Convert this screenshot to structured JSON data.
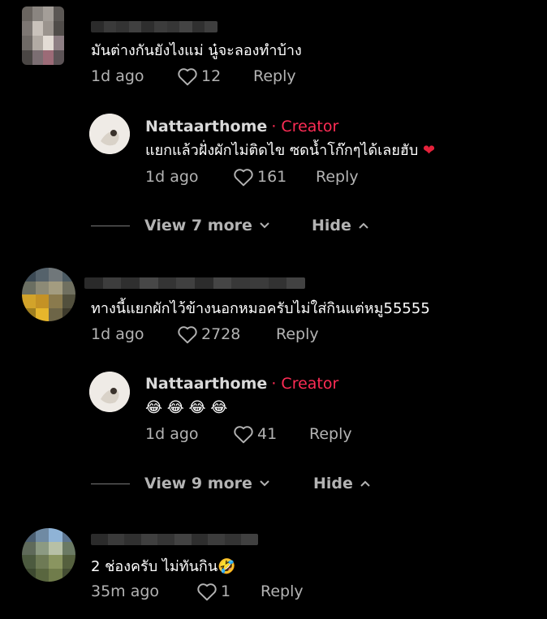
{
  "comments": [
    {
      "text": "มันต่างกันยังไงแม่ นู๋จะลองทำบ้าง",
      "time": "1d ago",
      "likes": "12",
      "reply_label": "Reply",
      "avatar_colors": [
        "#6a6560",
        "#8a8580",
        "#a49e98",
        "#5b5754",
        "#7d7773",
        "#c9c2bb",
        "#9b948e",
        "#504c49",
        "#6f6a66",
        "#b2aba4",
        "#e3dcd5",
        "#8e7f84",
        "#4a4644",
        "#7b6e72",
        "#9c6b77",
        "#5c5356"
      ],
      "name_colors": [
        "#2b2b2b",
        "#3a3a3a",
        "#333",
        "#404040",
        "#2e2e2e",
        "#3c3c3c",
        "#363636",
        "#444",
        "#303030",
        "#3e3e3e"
      ],
      "reply": {
        "author": "Nattaarthome",
        "tag": "· Creator",
        "text": "แยกแล้วฝั่งผักไม่ติดไข ซดน้ำโก๊กๆได้เลยฮับ",
        "emoji": "❤",
        "time": "1d ago",
        "likes": "161",
        "reply_label": "Reply"
      },
      "view_more": "View 7 more",
      "hide": "Hide"
    },
    {
      "text": "ทางนี้แยกผักไว้ข้างนอกหมอครับไม่ใส่กินแต่หมู55555",
      "time": "1d ago",
      "likes": "2728",
      "reply_label": "Reply",
      "avatar_colors": [
        "#3c4a55",
        "#55626b",
        "#70777a",
        "#4b5a63",
        "#6b6f62",
        "#8c8a76",
        "#a39c80",
        "#707060",
        "#d2a32a",
        "#c49225",
        "#8a7a4d",
        "#52503d",
        "#a07f20",
        "#e6b62c",
        "#6d6547",
        "#3d3a2c"
      ],
      "name_colors": [
        "#2a2a2a",
        "#3d3d3d",
        "#2f2f2f",
        "#474747",
        "#343434",
        "#404040",
        "#2c2c2c",
        "#454545",
        "#383838",
        "#3b3b3b",
        "#323232",
        "#424242"
      ],
      "reply": {
        "author": "Nattaarthome",
        "tag": "· Creator",
        "text": "😂 😂 😂 😂",
        "emoji": "",
        "time": "1d ago",
        "likes": "41",
        "reply_label": "Reply"
      },
      "view_more": "View 9 more",
      "hide": "Hide"
    },
    {
      "text": "2 ช่องครับ ไม่ทันกิน🤣",
      "time": "35m ago",
      "likes": "1",
      "reply_label": "Reply",
      "avatar_colors": [
        "#4b5f72",
        "#6f8aa3",
        "#8fb3d6",
        "#5c7590",
        "#5f6a5a",
        "#8c9a82",
        "#b7c0a6",
        "#6b7a64",
        "#4c5a3f",
        "#6e7a55",
        "#8a9560",
        "#55603e",
        "#3e4a31",
        "#59663f",
        "#707c4b",
        "#444d33"
      ],
      "name_colors": [
        "#2b2b2b",
        "#3a3a3a",
        "#303030",
        "#3f3f3f",
        "#353535",
        "#424242",
        "#2e2e2e",
        "#3c3c3c",
        "#333333",
        "#404040"
      ]
    }
  ]
}
